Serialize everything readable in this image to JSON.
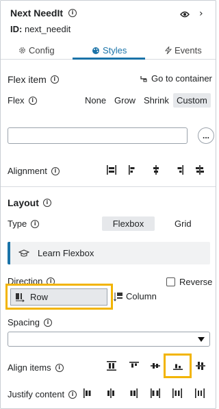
{
  "header": {
    "title": "Next NeedIt",
    "id_label": "ID:",
    "id_value": "next_needit"
  },
  "tabs": [
    {
      "label": "Config",
      "active": false
    },
    {
      "label": "Styles",
      "active": true
    },
    {
      "label": "Events",
      "active": false
    }
  ],
  "flex_item": {
    "title": "Flex item",
    "go_to_container": "Go to container",
    "flex_label": "Flex",
    "flex_options": [
      "None",
      "Grow",
      "Shrink",
      "Custom"
    ],
    "flex_selected": "Custom",
    "custom_value": "",
    "more_button": "...",
    "alignment_label": "Alignment"
  },
  "layout": {
    "title": "Layout",
    "type_label": "Type",
    "type_options": [
      "Flexbox",
      "Grid"
    ],
    "type_selected": "Flexbox",
    "learn_label": "Learn Flexbox",
    "direction_label": "Direction",
    "reverse_label": "Reverse",
    "reverse_checked": false,
    "direction_options": [
      "Row",
      "Column"
    ],
    "direction_selected": "Row",
    "spacing_label": "Spacing",
    "spacing_value": "",
    "align_items_label": "Align items",
    "justify_content_label": "Justify content"
  },
  "colors": {
    "accent": "#1a73a8",
    "highlight": "#f2b400"
  }
}
